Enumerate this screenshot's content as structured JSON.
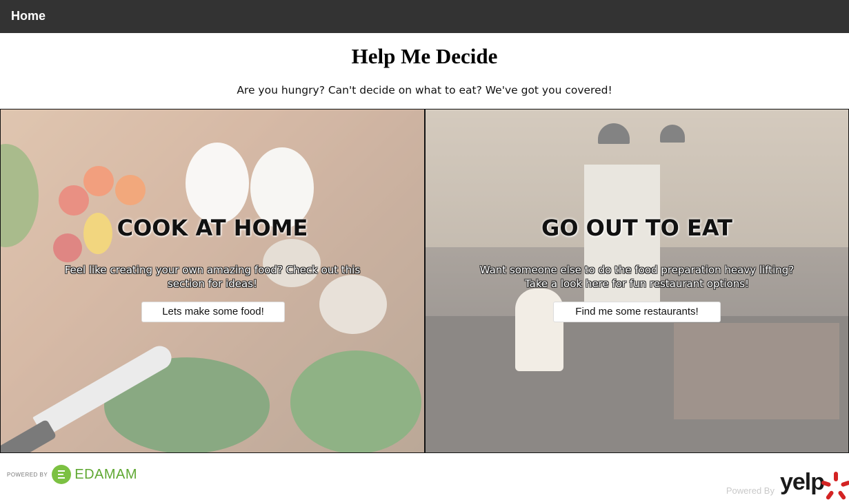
{
  "nav": {
    "home_label": "Home"
  },
  "header": {
    "title": "Help Me Decide",
    "subtitle": "Are you hungry? Can't decide on what to eat? We've got you covered!"
  },
  "panels": [
    {
      "heading": "COOK AT HOME",
      "description": "Feel like creating your own amazing food? Check out this section for ideas!",
      "button_label": "Lets make some food!"
    },
    {
      "heading": "GO OUT TO EAT",
      "description": "Want someone else to do the food preparation heavy lifting? Take a look here for fun restaurant options!",
      "button_label": "Find me some restaurants!"
    }
  ],
  "footer": {
    "edamam_small": "POWERED BY",
    "edamam_brand": "EDAMAM",
    "yelp_small": "Powered By",
    "yelp_brand": "yelp"
  },
  "icons": [
    "edamam-logo-icon",
    "yelp-burst-icon"
  ],
  "colors": {
    "navbar": "#333333",
    "edamam_green": "#7cc142",
    "yelp_red": "#d32323"
  }
}
